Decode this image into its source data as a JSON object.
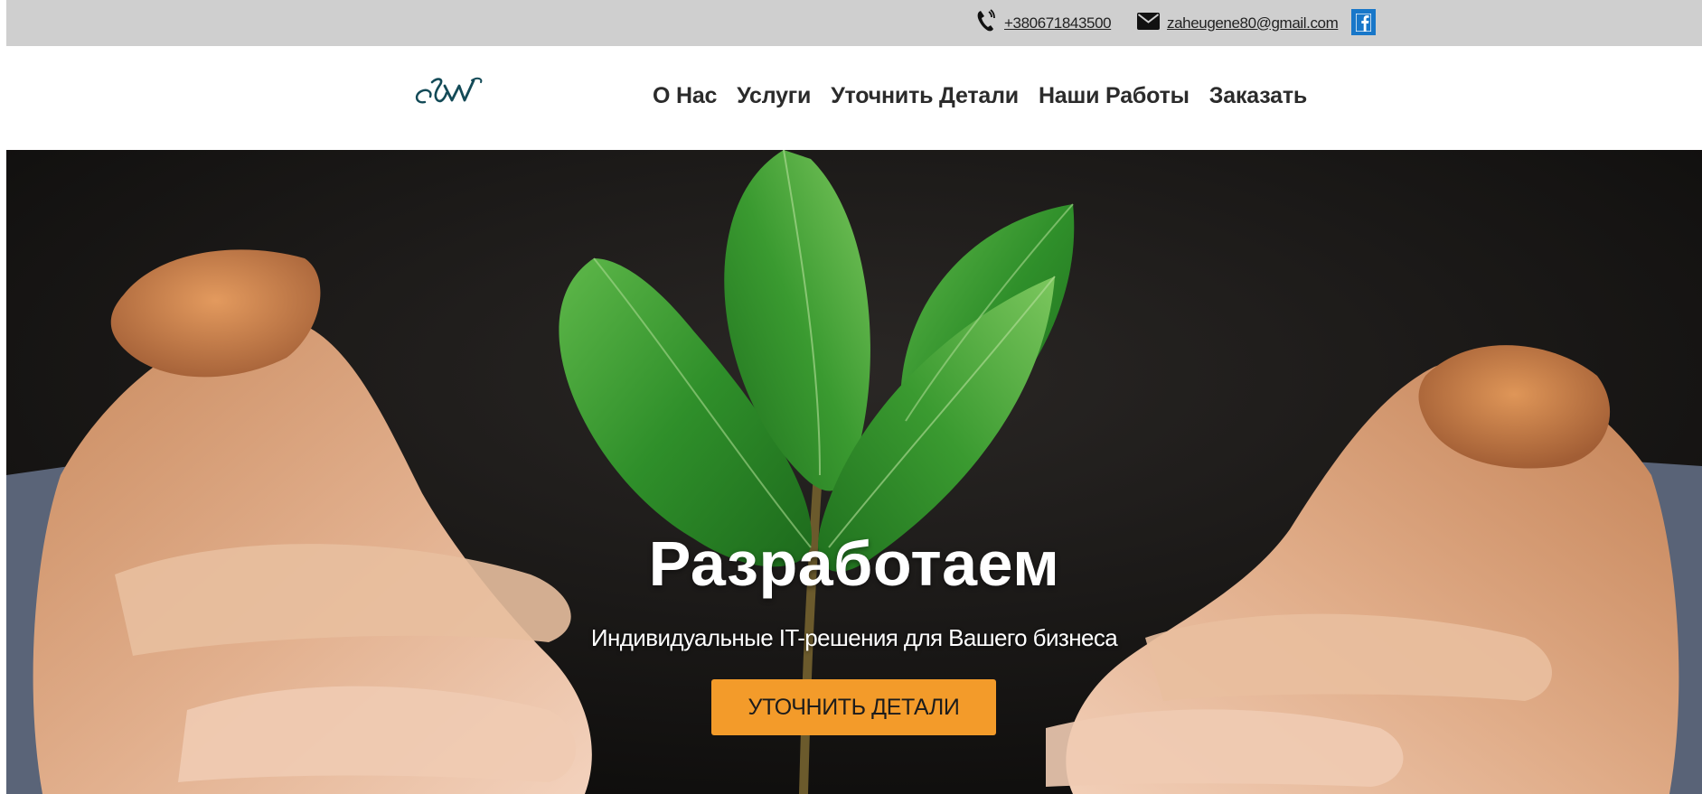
{
  "topbar": {
    "phone": "+380671843500",
    "email": "zaheugene80@gmail.com",
    "icons": {
      "phone": "phone-icon",
      "email": "envelope-icon",
      "social": "facebook-icon"
    },
    "facebook_color": "#1877c9",
    "background": "#cfcfcf"
  },
  "header": {
    "logo_icon": "logo-icon",
    "nav": [
      {
        "label": "О Нас"
      },
      {
        "label": "Услуги"
      },
      {
        "label": "Уточнить Детали"
      },
      {
        "label": "Наши Работы"
      },
      {
        "label": "Заказать"
      }
    ]
  },
  "hero": {
    "title": "Разработаем",
    "subtitle": "Индивидуальные IT-решения для Вашего бизнеса",
    "cta_label": "УТОЧНИТЬ ДЕТАЛИ",
    "cta_color": "#f39b2a",
    "background_image": "hands-holding-plant-sprout"
  }
}
